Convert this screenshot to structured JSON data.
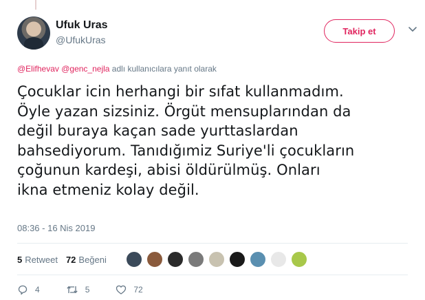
{
  "author": {
    "name": "Ufuk Uras",
    "handle": "@UfukUras"
  },
  "follow_button_label": "Takip et",
  "reply_context": {
    "mention_1": "@Elifhevav",
    "mention_2": "@genc_nejla",
    "suffix": "adlı kullanıcılara yanıt olarak"
  },
  "tweet": {
    "lines": [
      "Çocuklar icin herhangi bir sıfat kullanmadım.",
      "Öyle yazan sizsiniz. Örgüt mensuplarından da",
      "değil buraya kaçan sade yurttaslardan",
      "bahsediyorum. Tanıdığımiz Suriye'li çocukların",
      "çoğunun kardeşi, abisi öldürülmüş. Onları",
      "ikna etmeniz kolay değil."
    ],
    "timestamp": "08:36 - 16 Nis 2019"
  },
  "stats": {
    "retweets_count": "5",
    "retweets_label": "Retweet",
    "likes_count": "72",
    "likes_label": "Beğeni"
  },
  "liker_avatars": [
    {
      "color": "#3b4a5a"
    },
    {
      "color": "#8a5a3c"
    },
    {
      "color": "#2b2b2b"
    },
    {
      "color": "#7a7a7a"
    },
    {
      "color": "#c8c2b0"
    },
    {
      "color": "#1a1a1a"
    },
    {
      "color": "#5a8fb0"
    },
    {
      "color": "#e8e8e8"
    },
    {
      "color": "#a8c84a"
    }
  ],
  "actions": {
    "replies": "4",
    "retweets": "5",
    "likes": "72"
  },
  "colors": {
    "accent": "#e0245e",
    "secondary_text": "#657786",
    "primary_text": "#14171a"
  }
}
